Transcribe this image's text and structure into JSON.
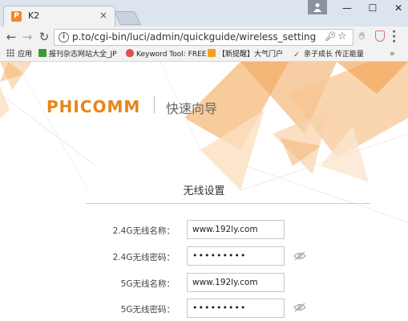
{
  "browser": {
    "tab_title": "K2",
    "tab_favicon_letter": "P",
    "tab_close": "×",
    "window_min": "—",
    "window_max": "☐",
    "window_close": "✕",
    "url": "p.to/cgi-bin/luci/admin/quickguide/wireless_setting",
    "bookmarks": [
      {
        "label": "应用",
        "icon": "apps-grid-icon",
        "color": "#555555"
      },
      {
        "label": "报刊杂志网站大全_JP",
        "icon": "bookmark-c-icon",
        "color": "#3a9a3a"
      },
      {
        "label": "Keyword Tool: FREE",
        "icon": "bookmark-flame-icon",
        "color": "#d9534f"
      },
      {
        "label": "【新提醒】大气门户",
        "icon": "bookmark-hat-icon",
        "color": "#f0a020"
      },
      {
        "label": "亲子成长 传正能量",
        "icon": "bookmark-check-icon",
        "color": "#c0392b"
      }
    ],
    "bookmarks_more": "»"
  },
  "page": {
    "logo": "PHICOMM",
    "logo_subtitle": "快速向导",
    "section_title": "无线设置",
    "rows": [
      {
        "label": "2.4G无线名称：",
        "value": "www.192ly.com",
        "type": "text"
      },
      {
        "label": "2.4G无线密码：",
        "value": "•••••••••",
        "type": "password"
      },
      {
        "label": "5G无线名称：",
        "value": "www.192ly.com",
        "type": "text"
      },
      {
        "label": "5G无线密码：",
        "value": "•••••••••",
        "type": "password"
      }
    ],
    "accent_color": "#e8841a"
  }
}
